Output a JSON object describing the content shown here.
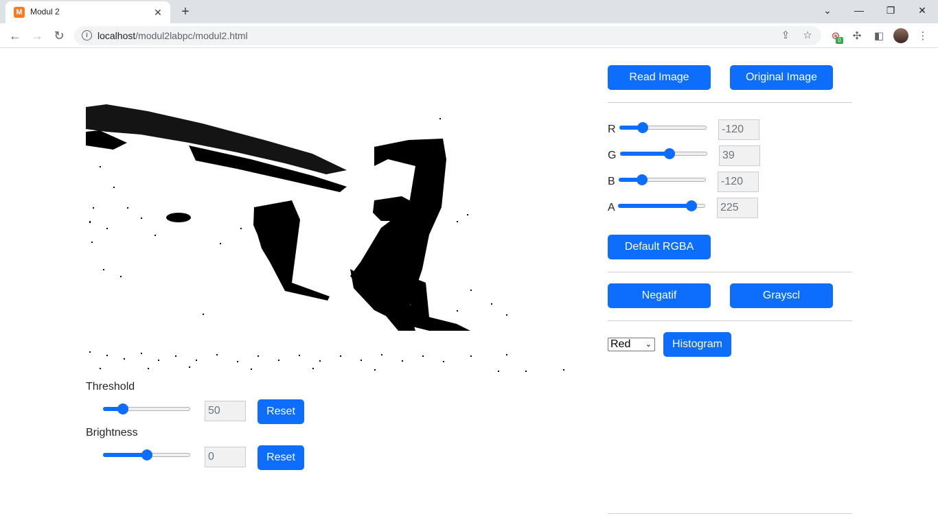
{
  "browser": {
    "tab_title": "Modul 2",
    "favicon_letter": "M",
    "url_host": "localhost",
    "url_path": "/modul2labpc/modul2.html",
    "extension_badge": "0"
  },
  "left_panel": {
    "threshold": {
      "label": "Threshold",
      "value": "50",
      "fraction": 0.23,
      "reset_label": "Reset"
    },
    "brightness": {
      "label": "Brightness",
      "value": "0",
      "fraction": 0.5,
      "reset_label": "Reset"
    }
  },
  "right_panel": {
    "read_image_label": "Read Image",
    "original_image_label": "Original Image",
    "rgba": [
      {
        "key": "R",
        "value": "-120",
        "fraction": 0.27
      },
      {
        "key": "G",
        "value": "39",
        "fraction": 0.57
      },
      {
        "key": "B",
        "value": "-120",
        "fraction": 0.27
      },
      {
        "key": "A",
        "value": "225",
        "fraction": 0.84
      }
    ],
    "default_rgba_label": "Default RGBA",
    "negatif_label": "Negatif",
    "grayscale_label": "Grayscl",
    "channel_select_value": "Red",
    "histogram_label": "Histogram"
  },
  "colors": {
    "accent": "#0d6efd"
  }
}
